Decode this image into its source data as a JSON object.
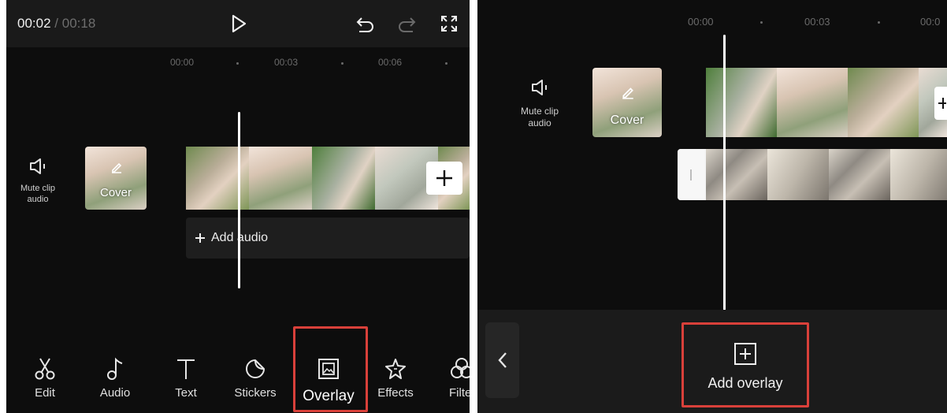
{
  "left": {
    "time_current": "00:02",
    "time_sep": "/",
    "time_total": "00:18",
    "ruler": [
      "00:00",
      "00:03",
      "00:06"
    ],
    "mute_label": "Mute clip audio",
    "cover_label": "Cover",
    "add_audio_label": "Add audio",
    "toolbar": [
      {
        "label": "Edit",
        "icon": "scissors-icon"
      },
      {
        "label": "Audio",
        "icon": "music-note-icon"
      },
      {
        "label": "Text",
        "icon": "text-icon"
      },
      {
        "label": "Stickers",
        "icon": "sticker-icon"
      },
      {
        "label": "Overlay",
        "icon": "overlay-icon"
      },
      {
        "label": "Effects",
        "icon": "effects-star-icon"
      },
      {
        "label": "Filte",
        "icon": "filters-icon"
      }
    ]
  },
  "right": {
    "ruler": [
      "00:00",
      "00:03",
      "00:0"
    ],
    "mute_label": "Mute clip audio",
    "cover_label": "Cover",
    "add_overlay_label": "Add overlay"
  },
  "colors": {
    "highlight": "#d9403a",
    "background": "#0d0d0d",
    "topbar": "#1a1a1a"
  }
}
